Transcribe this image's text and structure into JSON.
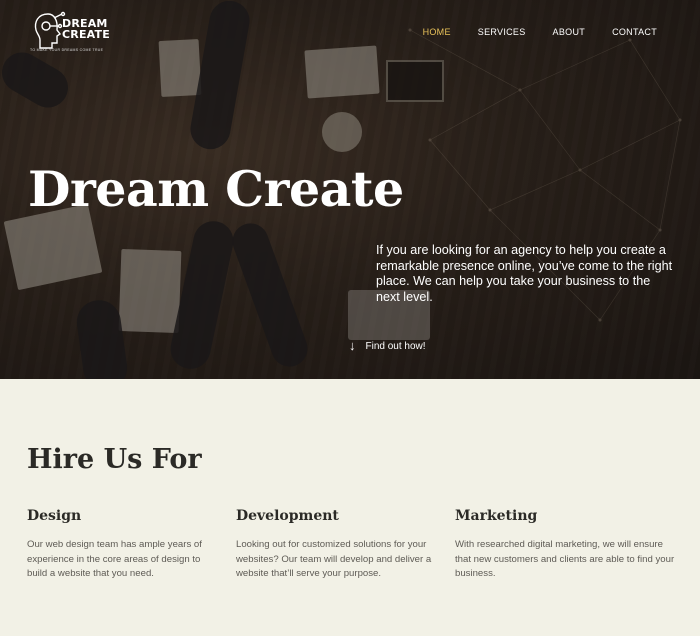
{
  "brand": {
    "logo_line1": "DREAM",
    "logo_line2": "CREATE",
    "tagline": "TO MAKE YOUR DREAMS COME TRUE"
  },
  "nav": {
    "items": [
      {
        "label": "HOME",
        "active": true
      },
      {
        "label": "SERVICES",
        "active": false
      },
      {
        "label": "ABOUT",
        "active": false
      },
      {
        "label": "CONTACT",
        "active": false
      }
    ],
    "active_color": "#e8c25a"
  },
  "hero": {
    "title": "Dream Create",
    "text": "If you are looking for an agency to help you create a remarkable presence online, you’ve come to the right place. We can help you take your business to the next level.",
    "cta_label": "Find out how!",
    "cta_icon": "arrow-down-icon"
  },
  "hire": {
    "title": "Hire Us For",
    "services": [
      {
        "title": "Design",
        "text": "Our web design team has ample years of experience in the core areas of design to build a website that you need."
      },
      {
        "title": "Development",
        "text": "Looking out for customized solutions for your websites? Our team will develop and deliver a website that’ll serve your purpose."
      },
      {
        "title": "Marketing",
        "text": "With researched digital marketing, we will ensure that new customers and clients are able to find your business."
      }
    ]
  },
  "colors": {
    "page_background": "#f2f1e6",
    "heading": "#2b2a26",
    "body_text": "#5e5b55"
  }
}
